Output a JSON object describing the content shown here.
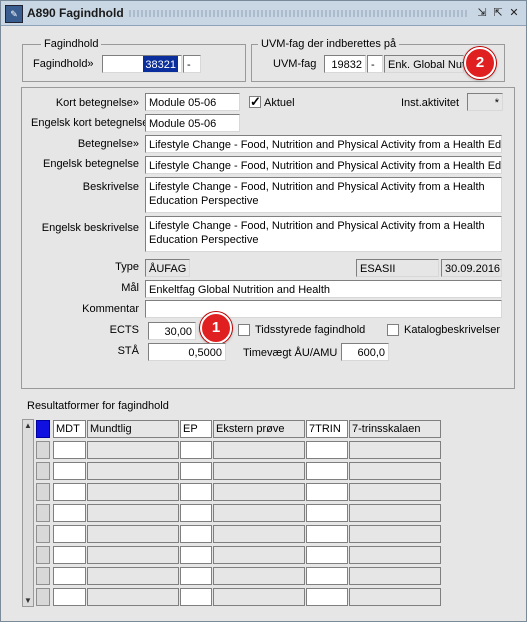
{
  "window": {
    "title": "A890 Fagindhold"
  },
  "fagindhold_group": {
    "title": "Fagindhold",
    "label": "Fagindhold»",
    "value": "38321",
    "suffix": "-"
  },
  "uvm_group": {
    "title": "UVM-fag der indberettes på",
    "label": "UVM-fag",
    "code": "19832",
    "suffix": "-",
    "name": "Enk. Global Nut"
  },
  "fields": {
    "kort_betegnelse_label": "Kort betegnelse»",
    "kort_betegnelse": "Module 05-06",
    "aktuel_label": "Aktuel",
    "inst_aktivitet_label": "Inst.aktivitet",
    "inst_aktivitet_value": "*",
    "engelsk_kort_label": "Engelsk kort betegnelse",
    "engelsk_kort": "Module 05-06",
    "betegnelse_label": "Betegnelse»",
    "betegnelse": "Lifestyle Change - Food, Nutrition and Physical Activity from a Health Educ",
    "engelsk_betegnelse_label": "Engelsk betegnelse",
    "engelsk_betegnelse": "Lifestyle Change - Food, Nutrition and Physical Activity from a Health Educ",
    "beskrivelse_label": "Beskrivelse",
    "beskrivelse": "Lifestyle Change - Food, Nutrition and Physical Activity from a Health Education Perspective",
    "engelsk_beskrivelse_label": "Engelsk beskrivelse",
    "engelsk_beskrivelse": "Lifestyle Change - Food, Nutrition and Physical Activity from a Health Education Perspective",
    "type_label": "Type",
    "type": "ÅUFAG",
    "type_source": "ESASII",
    "type_date": "30.09.2016",
    "maal_label": "Mål",
    "maal": "Enkeltfag Global Nutrition and Health",
    "kommentar_label": "Kommentar",
    "kommentar": "",
    "ects_label": "ECTS",
    "ects": "30,00",
    "tidsstyrede_label": "Tidsstyrede fagindhold",
    "katalog_label": "Katalogbeskrivelser",
    "staa_label": "STÅ",
    "staa": "0,5000",
    "timevaegt_label": "Timevægt ÅU/AMU",
    "timevaegt": "600,0"
  },
  "badges": {
    "one": "1",
    "two": "2"
  },
  "resultatformer": {
    "title": "Resultatformer for fagindhold",
    "header": [
      "MDT",
      "Mundtlig",
      "EP",
      "Ekstern prøve",
      "7TRIN",
      "7-trinsskalaen"
    ]
  },
  "colors": {
    "badge": "#e02020",
    "selection": "#0a2e9c",
    "indicator": "#1010e0"
  }
}
